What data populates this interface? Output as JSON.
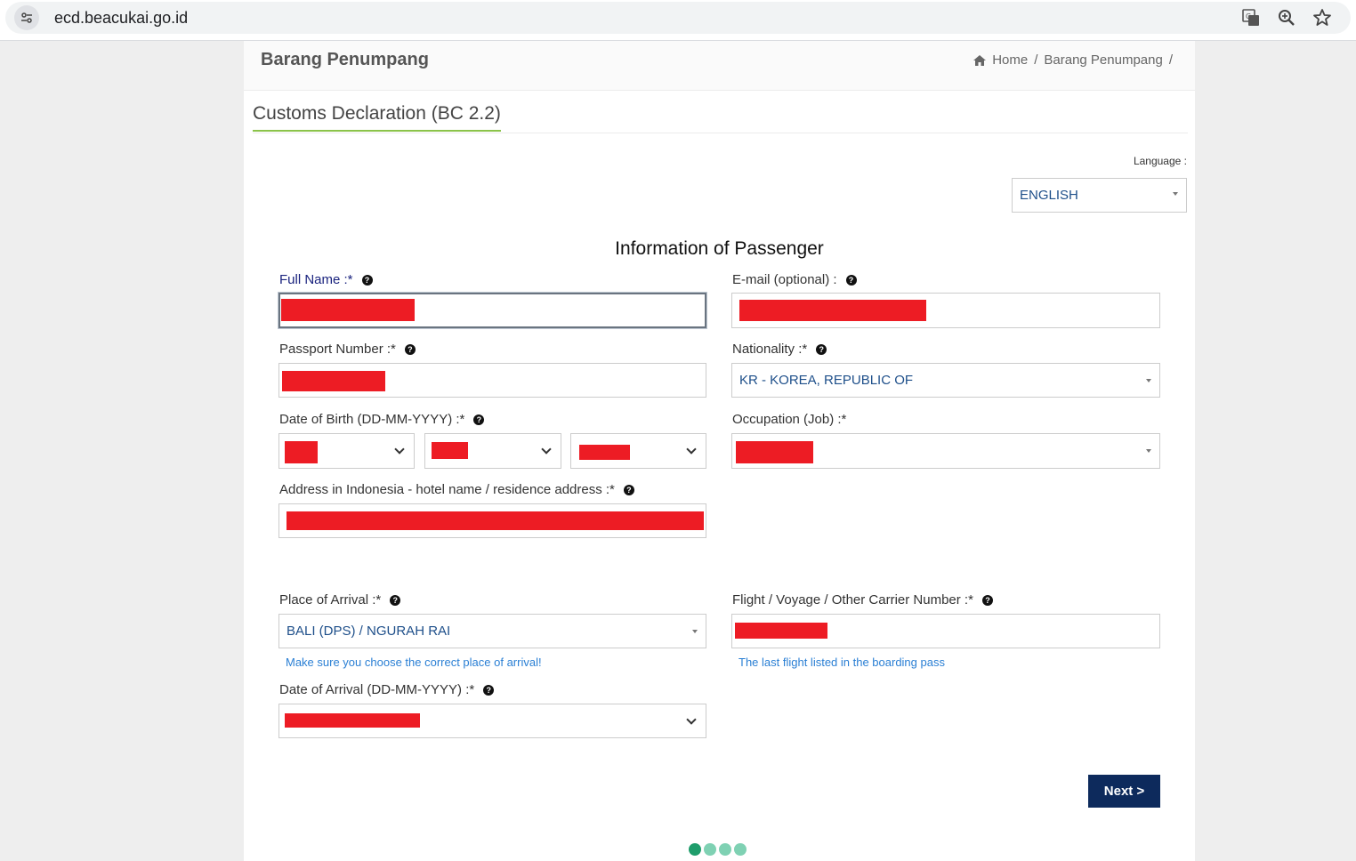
{
  "browser": {
    "url": "ecd.beacukai.go.id",
    "icons": [
      "site-settings-icon",
      "translate-icon",
      "zoom-icon",
      "bookmark-star-icon"
    ]
  },
  "header": {
    "title": "Barang Penumpang",
    "breadcrumb": {
      "home": "Home",
      "current": "Barang Penumpang",
      "sep": "/"
    }
  },
  "tab": {
    "title": "Customs Declaration (BC 2.2)"
  },
  "language": {
    "label": "Language :",
    "selected": "ENGLISH"
  },
  "form": {
    "section_title": "Information of Passenger",
    "full_name_label": "Full Name :*",
    "email_label": "E-mail (optional) :",
    "passport_label": "Passport Number :*",
    "nationality_label": "Nationality :*",
    "nationality_value": "KR - KOREA, REPUBLIC OF",
    "dob_label": "Date of Birth (DD-MM-YYYY) :*",
    "occupation_label": "Occupation (Job) :*",
    "address_label": "Address in Indonesia - hotel name / residence address :*",
    "arrival_place_label": "Place of Arrival :*",
    "arrival_place_value": "BALI (DPS) / NGURAH RAI",
    "arrival_place_hint": "Make sure you choose the correct place of arrival!",
    "flight_label": "Flight / Voyage / Other Carrier Number :*",
    "flight_hint": "The last flight listed in the boarding pass",
    "arrival_date_label": "Date of Arrival (DD-MM-YYYY) :*",
    "help_glyph": "?"
  },
  "actions": {
    "next_label": "Next >"
  },
  "progress": {
    "steps": 4,
    "current": 1
  },
  "colors": {
    "accent_green": "#8bc34a",
    "button_navy": "#0d2a5c",
    "redaction": "#ed1c24",
    "hint_blue": "#2a7fd4"
  }
}
